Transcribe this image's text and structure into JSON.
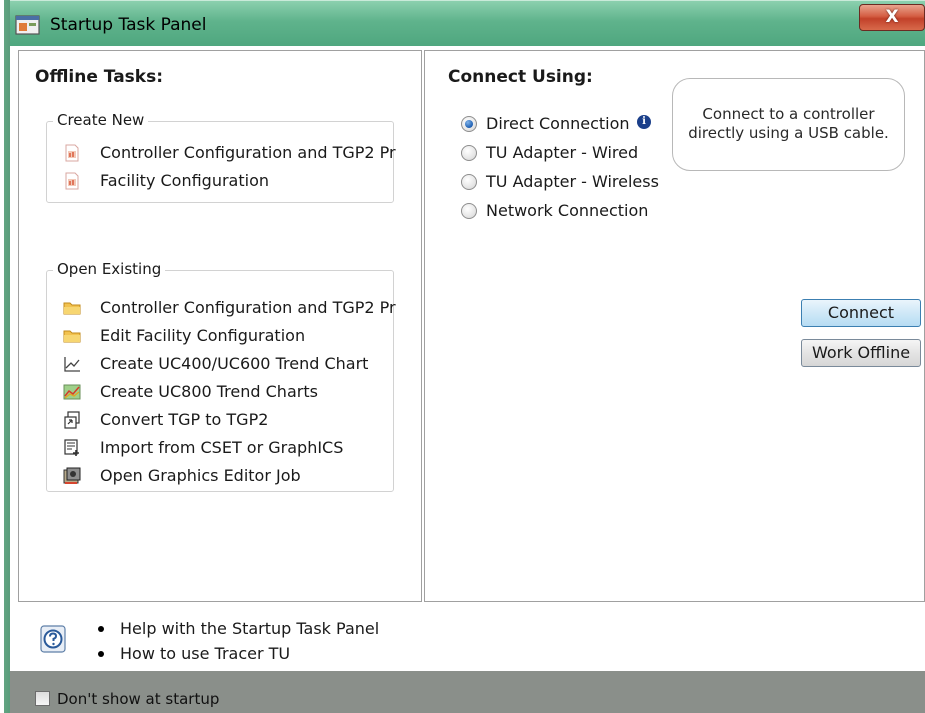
{
  "window": {
    "title": "Startup Task Panel",
    "close_glyph": "X"
  },
  "offline": {
    "heading": "Offline Tasks:",
    "create_new": {
      "legend": "Create New",
      "items": [
        {
          "label": "Controller Configuration and TGP2 Pr",
          "icon": "new-document-icon"
        },
        {
          "label": "Facility Configuration",
          "icon": "new-document-icon"
        }
      ]
    },
    "open_existing": {
      "legend": "Open Existing",
      "items": [
        {
          "label": "Controller Configuration and TGP2 Pr",
          "icon": "folder-icon"
        },
        {
          "label": "Edit Facility Configuration",
          "icon": "folder-icon"
        },
        {
          "label": "Create UC400/UC600 Trend Chart",
          "icon": "line-chart-icon"
        },
        {
          "label": "Create UC800 Trend Charts",
          "icon": "chart-image-icon"
        },
        {
          "label": "Convert TGP to TGP2",
          "icon": "convert-icon"
        },
        {
          "label": "Import from CSET or GraphICS",
          "icon": "import-icon"
        },
        {
          "label": "Open Graphics Editor Job",
          "icon": "graphics-job-icon"
        }
      ]
    }
  },
  "connect": {
    "heading": "Connect Using:",
    "options": [
      {
        "label": "Direct Connection",
        "checked": true
      },
      {
        "label": "TU Adapter - Wired",
        "checked": false
      },
      {
        "label": "TU Adapter - Wireless",
        "checked": false
      },
      {
        "label": "Network Connection",
        "checked": false
      }
    ],
    "info_glyph": "i",
    "tooltip": {
      "line1": "Connect to a controller",
      "line2": "directly using a USB cable."
    },
    "connect_button": "Connect",
    "offline_button": "Work Offline"
  },
  "help": {
    "icon": "help-question-icon",
    "links": [
      "Help with the Startup Task Panel",
      "How to use Tracer TU"
    ]
  },
  "footer": {
    "dont_show_label": "Don't show at startup",
    "dont_show_checked": false
  },
  "colors": {
    "titlebar": "#5fb38c",
    "close_button": "#c2412a",
    "footer": "#8a8f8a",
    "connect_button": "#cfe8f7",
    "radio_selected": "#1e5fb3"
  }
}
